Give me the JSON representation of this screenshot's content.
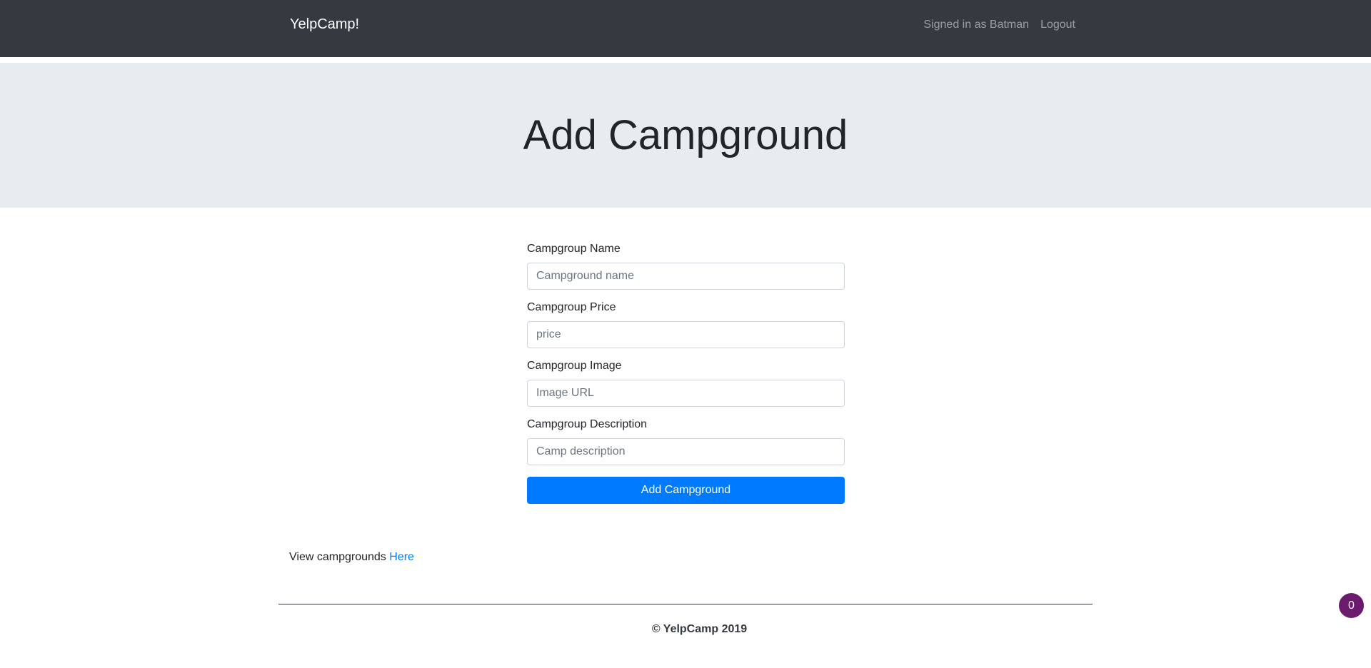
{
  "navbar": {
    "brand": "YelpCamp!",
    "signed_in_text": "Signed in as Batman",
    "logout_label": "Logout"
  },
  "header": {
    "title": "Add Campground"
  },
  "form": {
    "name": {
      "label": "Campgroup Name",
      "placeholder": "Campground name",
      "value": ""
    },
    "price": {
      "label": "Campgroup Price",
      "placeholder": "price",
      "value": ""
    },
    "image": {
      "label": "Campgroup Image",
      "placeholder": "Image URL",
      "value": ""
    },
    "description": {
      "label": "Campgroup Description",
      "placeholder": "Camp description",
      "value": ""
    },
    "submit_label": "Add Campground"
  },
  "view_link": {
    "prefix": "View campgrounds",
    "link_text": "Here"
  },
  "footer": {
    "text": "© YelpCamp 2019"
  },
  "badge": {
    "count": "0"
  },
  "colors": {
    "navbar_bg": "#343a40",
    "jumbotron_bg": "#e9ecef",
    "primary": "#007bff",
    "badge_bg": "#6a1b6e"
  }
}
